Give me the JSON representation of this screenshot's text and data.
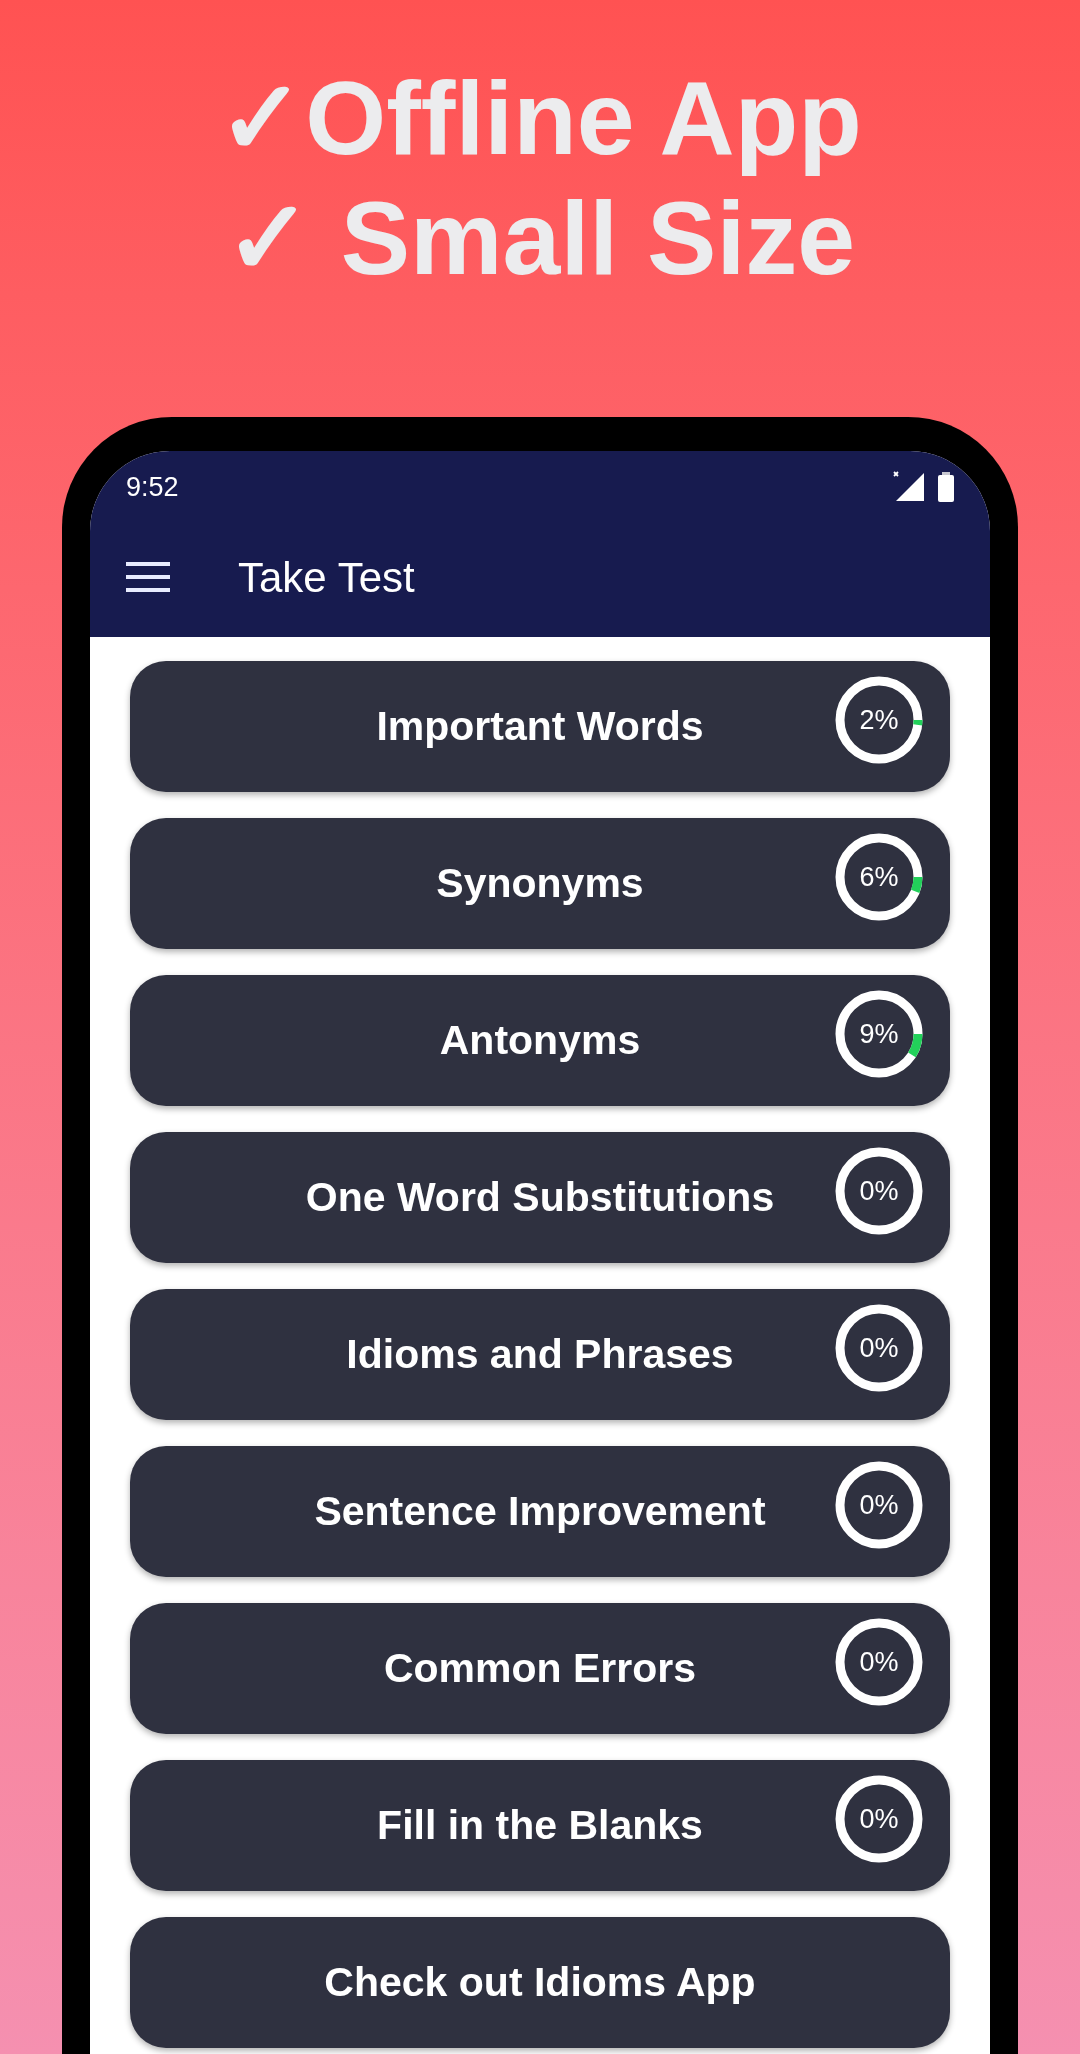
{
  "headline": [
    "✓Offline App",
    "✓ Small Size"
  ],
  "status_bar": {
    "time": "9:52"
  },
  "app_bar": {
    "title": "Take Test"
  },
  "items": [
    {
      "kind": "test",
      "label": "Important Words",
      "level": 0.02,
      "reading": "2%"
    },
    {
      "kind": "test",
      "label": "Synonyms",
      "level": 0.06,
      "reading": "6%"
    },
    {
      "kind": "test",
      "label": "Antonyms",
      "level": 0.09,
      "reading": "9%"
    },
    {
      "kind": "test",
      "label": "One Word Substitutions",
      "level": 0,
      "reading": "0%"
    },
    {
      "kind": "test",
      "label": "Idioms and Phrases",
      "level": 0,
      "reading": "0%"
    },
    {
      "kind": "test",
      "label": "Sentence Improvement",
      "level": 0,
      "reading": "0%"
    },
    {
      "kind": "test",
      "label": "Common Errors",
      "level": 0,
      "reading": "0%"
    },
    {
      "kind": "test",
      "label": "Fill in the Blanks",
      "level": 0,
      "reading": "0%"
    },
    {
      "kind": "link",
      "label": "Check out Idioms App"
    }
  ]
}
